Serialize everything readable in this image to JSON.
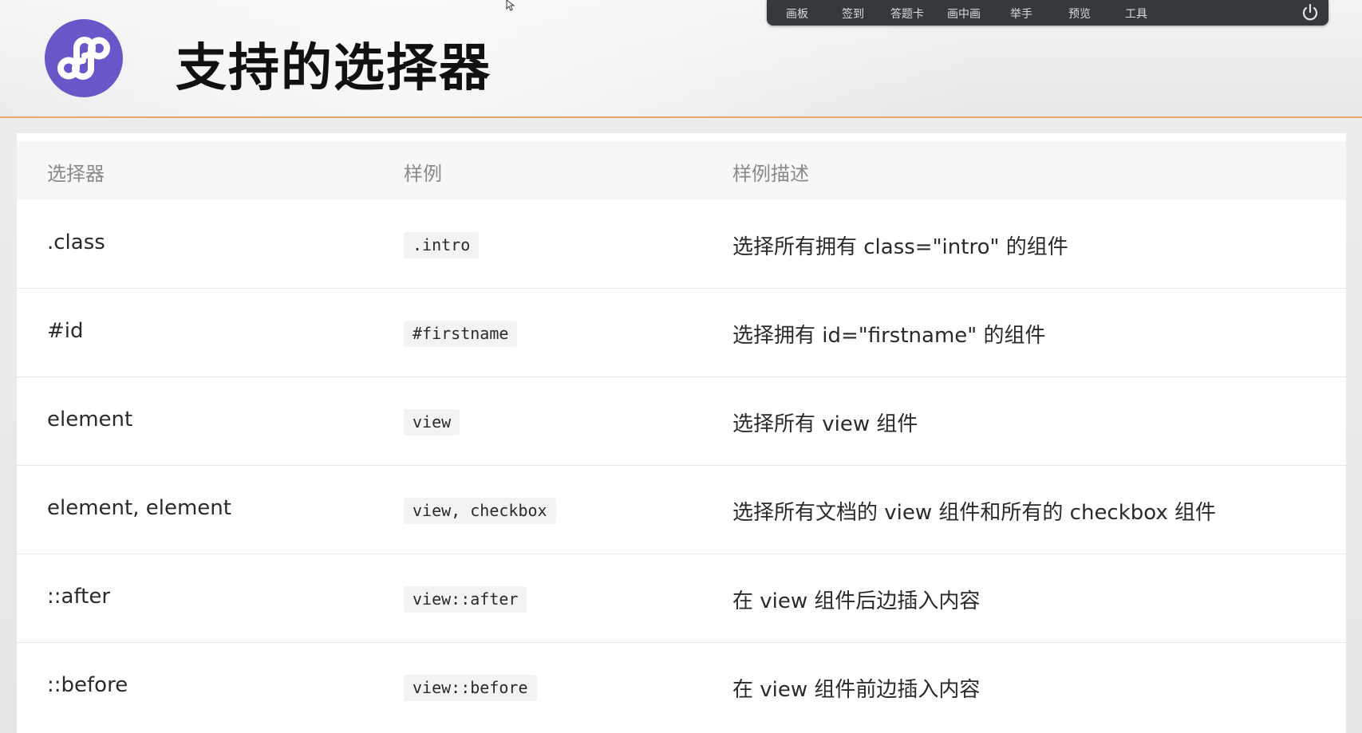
{
  "header": {
    "title": "支持的选择器",
    "logo_icon": "mini-program-logo-icon",
    "brand_color": "#6a55c9",
    "accent_line_color": "#e3a86a"
  },
  "toolbar": {
    "items": [
      "画板",
      "签到",
      "答题卡",
      "画中画",
      "举手",
      "预览",
      "工具"
    ],
    "power_icon": "power-icon"
  },
  "table": {
    "headers": [
      "选择器",
      "样例",
      "样例描述"
    ],
    "rows": [
      {
        "selector": ".class",
        "example": ".intro",
        "description": "选择所有拥有 class=\"intro\" 的组件"
      },
      {
        "selector": "#id",
        "example": "#firstname",
        "description": "选择拥有 id=\"firstname\" 的组件"
      },
      {
        "selector": "element",
        "example": "view",
        "description": "选择所有 view 组件"
      },
      {
        "selector": "element, element",
        "example": "view, checkbox",
        "description": "选择所有文档的 view 组件和所有的 checkbox 组件"
      },
      {
        "selector": "::after",
        "example": "view::after",
        "description": "在 view 组件后边插入内容"
      },
      {
        "selector": "::before",
        "example": "view::before",
        "description": "在 view 组件前边插入内容"
      }
    ]
  }
}
